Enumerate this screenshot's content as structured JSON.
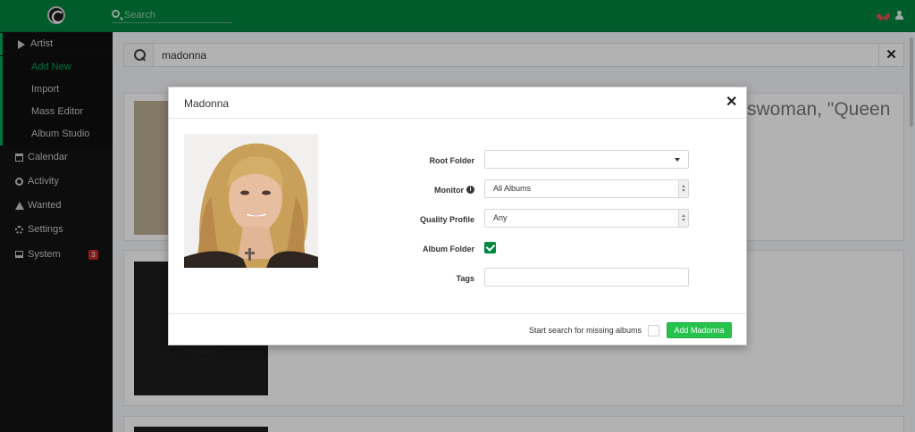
{
  "header": {
    "search_placeholder": "Search",
    "logo_icon": "logo-icon",
    "heart_icon": "heart-icon",
    "user_icon": "user-icon",
    "brand_color": "#00853d"
  },
  "sidebar": {
    "items": [
      {
        "label": "Artist",
        "icon": "play-icon"
      },
      {
        "label": "Add New",
        "sub": true,
        "active": true
      },
      {
        "label": "Import",
        "sub": true
      },
      {
        "label": "Mass Editor",
        "sub": true
      },
      {
        "label": "Album Studio",
        "sub": true
      },
      {
        "label": "Calendar",
        "icon": "calendar-icon"
      },
      {
        "label": "Activity",
        "icon": "clock-icon"
      },
      {
        "label": "Wanted",
        "icon": "warning-icon"
      },
      {
        "label": "Settings",
        "icon": "gears-icon"
      },
      {
        "label": "System",
        "icon": "laptop-icon",
        "badge": "3"
      }
    ]
  },
  "main": {
    "search_value": "madonna",
    "clear_label": "✕",
    "background_text": "swoman, \"Queen"
  },
  "modal": {
    "title": "Madonna",
    "close_label": "✕",
    "fields": {
      "root_folder": {
        "label": "Root Folder",
        "value": ""
      },
      "monitor": {
        "label": "Monitor",
        "value": "All Albums",
        "info": "i"
      },
      "quality_profile": {
        "label": "Quality Profile",
        "value": "Any"
      },
      "album_folder": {
        "label": "Album Folder",
        "checked": true
      },
      "tags": {
        "label": "Tags",
        "value": ""
      }
    },
    "footer": {
      "search_missing_label": "Start search for missing albums",
      "search_missing_checked": false,
      "add_button_label": "Add Madonna"
    }
  }
}
